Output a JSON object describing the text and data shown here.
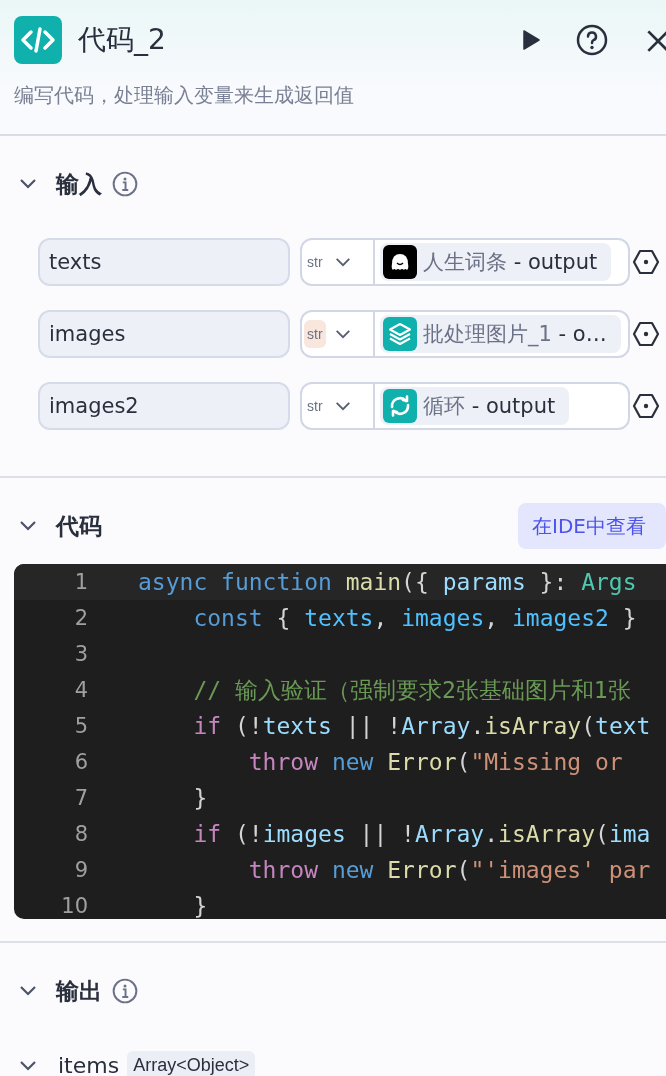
{
  "header": {
    "title": "代码_2",
    "description": "编写代码，处理输入变量来生成返回值"
  },
  "input_section": {
    "title": "输入",
    "expanded": true,
    "rows": [
      {
        "name": "texts",
        "type": "str",
        "highlighted": false,
        "source": {
          "kind": "ghost",
          "node": "人生词条",
          "output": "- output"
        }
      },
      {
        "name": "images",
        "type": "str",
        "highlighted": true,
        "source": {
          "kind": "layers",
          "node": "批处理图片_1",
          "output": "- o…"
        }
      },
      {
        "name": "images2",
        "type": "str",
        "highlighted": false,
        "source": {
          "kind": "loop",
          "node": "循环",
          "output": "- output"
        }
      }
    ]
  },
  "code_section": {
    "title": "代码",
    "expanded": true,
    "ide_button": "在IDE中查看",
    "lines": [
      {
        "number": "1",
        "tokens": [
          {
            "kind": "keyword",
            "text": "async function "
          },
          {
            "kind": "function",
            "text": "main"
          },
          {
            "kind": "plain",
            "text": "({ "
          },
          {
            "kind": "variable",
            "text": "params"
          },
          {
            "kind": "plain",
            "text": " }: "
          },
          {
            "kind": "type",
            "text": "Args"
          }
        ]
      },
      {
        "number": "2",
        "tokens": [
          {
            "kind": "keyword",
            "text": "    const "
          },
          {
            "kind": "plain",
            "text": "{ "
          },
          {
            "kind": "constant",
            "text": "texts"
          },
          {
            "kind": "plain",
            "text": ", "
          },
          {
            "kind": "constant",
            "text": "images"
          },
          {
            "kind": "plain",
            "text": ", "
          },
          {
            "kind": "constant",
            "text": "images2"
          },
          {
            "kind": "plain",
            "text": " }"
          }
        ]
      },
      {
        "number": "3"
      },
      {
        "number": "4",
        "tokens": [
          {
            "kind": "comment",
            "text": "    // 输入验证（强制要求2张基础图片和1张"
          }
        ]
      },
      {
        "number": "5",
        "tokens": [
          {
            "kind": "control",
            "text": "    if "
          },
          {
            "kind": "plain",
            "text": "(!"
          },
          {
            "kind": "variable",
            "text": "texts"
          },
          {
            "kind": "plain",
            "text": " || !"
          },
          {
            "kind": "variable",
            "text": "Array"
          },
          {
            "kind": "plain",
            "text": "."
          },
          {
            "kind": "function",
            "text": "isArray"
          },
          {
            "kind": "plain",
            "text": "("
          },
          {
            "kind": "variable",
            "text": "text"
          }
        ]
      },
      {
        "number": "6",
        "tokens": [
          {
            "kind": "control",
            "text": "        throw "
          },
          {
            "kind": "keyword",
            "text": "new "
          },
          {
            "kind": "function",
            "text": "Error"
          },
          {
            "kind": "plain",
            "text": "("
          },
          {
            "kind": "string",
            "text": "\"Missing or "
          }
        ]
      },
      {
        "number": "7",
        "tokens": [
          {
            "kind": "plain",
            "text": "    }"
          }
        ]
      },
      {
        "number": "8",
        "tokens": [
          {
            "kind": "control",
            "text": "    if "
          },
          {
            "kind": "plain",
            "text": "(!"
          },
          {
            "kind": "variable",
            "text": "images"
          },
          {
            "kind": "plain",
            "text": " || !"
          },
          {
            "kind": "variable",
            "text": "Array"
          },
          {
            "kind": "plain",
            "text": "."
          },
          {
            "kind": "function",
            "text": "isArray"
          },
          {
            "kind": "plain",
            "text": "("
          },
          {
            "kind": "variable",
            "text": "ima"
          }
        ]
      },
      {
        "number": "9",
        "tokens": [
          {
            "kind": "control",
            "text": "        throw "
          },
          {
            "kind": "keyword",
            "text": "new "
          },
          {
            "kind": "function",
            "text": "Error"
          },
          {
            "kind": "plain",
            "text": "("
          },
          {
            "kind": "string",
            "text": "\"'images' par"
          }
        ]
      },
      {
        "number": "10",
        "tokens": [
          {
            "kind": "plain",
            "text": "    }"
          }
        ]
      }
    ]
  },
  "output_section": {
    "title": "输出",
    "expanded": true,
    "items": [
      {
        "name": "items",
        "type": "Array<Object>",
        "expanded": true
      }
    ]
  }
}
